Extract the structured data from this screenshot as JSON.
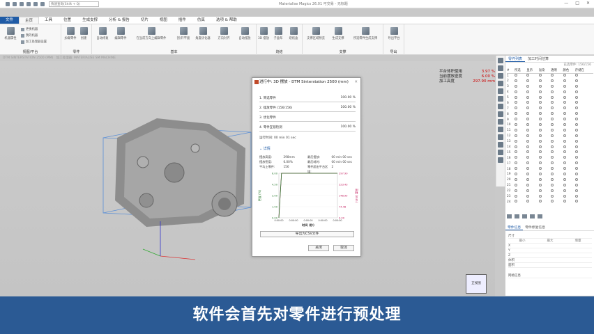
{
  "app": {
    "title": "Materialise Magics 26.01 可交易 - 无标题",
    "search_placeholder": "快速查询(Shift + Q)"
  },
  "tabs": [
    "文件",
    "主页",
    "工具",
    "位置",
    "生成支撑",
    "分析 & 报告",
    "切片",
    "视图",
    "插件",
    "仿真",
    "选项 & 帮助"
  ],
  "ribbon": {
    "groups": [
      {
        "label": "视图/平台",
        "items": [
          "机器属性"
        ],
        "small": [
          "更换机器",
          "我的机器",
          "加工处理器设置"
        ]
      },
      {
        "label": "零件",
        "items": [
          "加载零件",
          "创建"
        ]
      },
      {
        "label": "基本",
        "items": [
          "自动修复",
          "编辑零件",
          "在当前方向上编辑零件",
          "剖/开平面",
          "角度优化器",
          "方向对齐",
          "自动摆放"
        ]
      },
      {
        "label": "烧结",
        "items": [
          "3D 摆放",
          "子盒布",
          "烧结盒"
        ]
      },
      {
        "label": "支撑",
        "items": [
          "支撑区域预览",
          "生成支撑",
          "所选零件生成支撑"
        ]
      },
      {
        "label": "导出",
        "items": [
          "导出平台"
        ]
      }
    ]
  },
  "path": {
    "machine": "DTM SINTERSTATION 2500 (MM)",
    "processor": "加工处理器: MATERIALISE SM MACHINE"
  },
  "stats": [
    {
      "label": "平台体积使用",
      "value": "3.97 %"
    },
    {
      "label": "当前摆放密度",
      "value": "6.00 %"
    },
    {
      "label": "加工高度",
      "value": "297.90 mm"
    }
  ],
  "right_panel": {
    "tabs": [
      "零件列表",
      "加工时间估算"
    ],
    "count": "已选零件: 156/156",
    "headers": [
      "#",
      "所选",
      "显示",
      "溢染",
      "透明",
      "颜色",
      "存储在"
    ],
    "rows": [
      "1",
      "2",
      "3",
      "4",
      "5",
      "6",
      "7",
      "8",
      "9",
      "10",
      "11",
      "12",
      "13",
      "14",
      "15",
      "16",
      "17",
      "18",
      "19",
      "20",
      "21",
      "22",
      "23",
      "24"
    ],
    "info_tabs": [
      "零件信息",
      "零件修复信息"
    ],
    "dims_title": "尺寸",
    "dims_headers": [
      "最小",
      "最大",
      "增量"
    ],
    "dims_rows": [
      "X",
      "Y",
      "Z",
      "体积",
      "面积"
    ],
    "fix_title": "网格信息"
  },
  "dialog": {
    "title": "进行中: 3D 摆放 - DTM Sinterstation 2500 (mm)",
    "steps": [
      {
        "label": "1. 筛选零件",
        "pct": "100.00 %"
      },
      {
        "label": "2. 摆放零件 (156/156)",
        "pct": "100.00 %"
      },
      {
        "label": "3. 优化零件",
        "pct": ""
      },
      {
        "label": "4. 零件互锁检测",
        "pct": "100.00 %"
      }
    ],
    "runtime": "运行时间: 00 min 01 sec",
    "details_label": "详情",
    "grid": [
      [
        "摆放高度:",
        "298mm",
        "最后摆放:",
        "00 min 00 sec"
      ],
      [
        "摆放密度:",
        "6.00%",
        "最后耗时:",
        "00 min 00 sec"
      ],
      [
        "平均上零件:",
        "156",
        "零件超出平台区域:",
        "2"
      ]
    ],
    "export_label": "导出为CSV文件",
    "close_label": "关闭",
    "cancel_label": "取消"
  },
  "chart_data": {
    "type": "line",
    "xlabel": "时间 (秒)",
    "ylabel_left": "密度 (%)",
    "ylabel_right": "高度 (mm)",
    "left_ticks": [
      "6.00",
      "4.50",
      "3.00",
      "1.50",
      "0.00"
    ],
    "right_ticks": [
      "297.90",
      "223.43",
      "148.95",
      "74.48",
      "0.00"
    ],
    "x_ticks": [
      "0:00:00",
      "0:00:00",
      "0:00:00",
      "0:00:00",
      "0:00:00"
    ],
    "series": [
      {
        "values": [
          0,
          297.9,
          297.9,
          297.9,
          297.9
        ],
        "color": "#c2185b"
      },
      {
        "values": [
          0,
          6.0,
          6.0,
          6.0,
          6.0
        ],
        "color": "#2e7d32"
      }
    ]
  },
  "caption": "软件会首先对零件进行预处理",
  "cube_label": "正视图",
  "colors": {
    "accent": "#1f5ba6",
    "caption_bg": "#2b5a94",
    "density": "#2e7d32",
    "height": "#c2185b"
  }
}
